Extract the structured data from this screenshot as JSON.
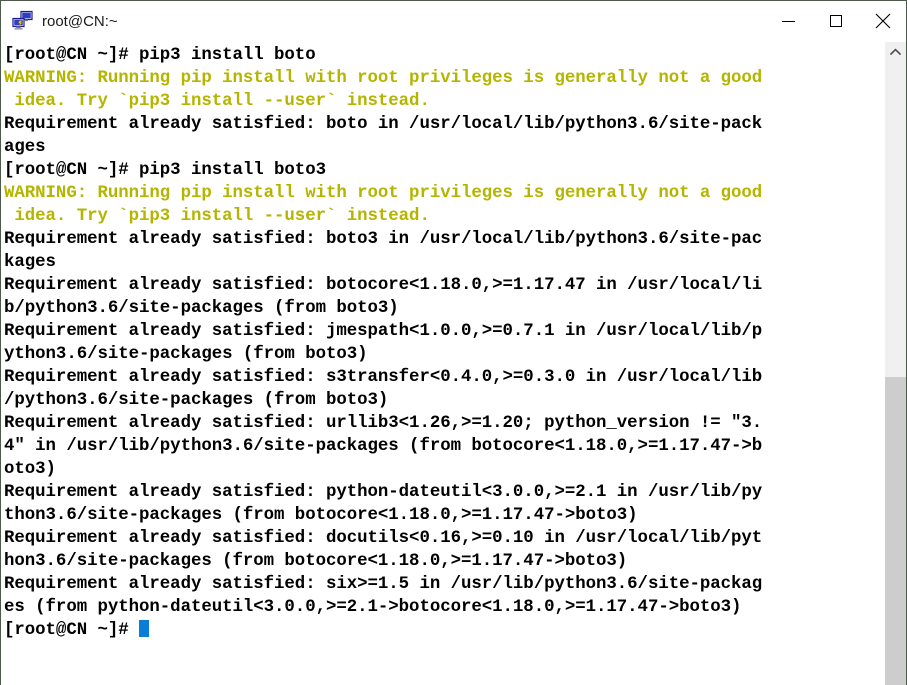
{
  "window": {
    "title": "root@CN:~",
    "icon": "putty-terminal-icon",
    "caption_buttons": [
      {
        "name": "minimize",
        "label": "—"
      },
      {
        "name": "maximize",
        "label": "□"
      },
      {
        "name": "close",
        "label": "✕"
      }
    ]
  },
  "terminal": {
    "prompt": "[root@CN ~]#",
    "colors": {
      "background": "#ffffff",
      "foreground": "#000000",
      "warning": "#b5b500",
      "cursor": "#0a7ed6"
    },
    "lines": [
      {
        "text": "[root@CN ~]# pip3 install boto",
        "color": "default"
      },
      {
        "text": "WARNING: Running pip install with root privileges is generally not a good",
        "color": "warning"
      },
      {
        "text": " idea. Try `pip3 install --user` instead.",
        "color": "warning"
      },
      {
        "text": "Requirement already satisfied: boto in /usr/local/lib/python3.6/site-pack",
        "color": "default"
      },
      {
        "text": "ages",
        "color": "default"
      },
      {
        "text": "[root@CN ~]# pip3 install boto3",
        "color": "default"
      },
      {
        "text": "WARNING: Running pip install with root privileges is generally not a good",
        "color": "warning"
      },
      {
        "text": " idea. Try `pip3 install --user` instead.",
        "color": "warning"
      },
      {
        "text": "Requirement already satisfied: boto3 in /usr/local/lib/python3.6/site-pac",
        "color": "default"
      },
      {
        "text": "kages",
        "color": "default"
      },
      {
        "text": "Requirement already satisfied: botocore<1.18.0,>=1.17.47 in /usr/local/li",
        "color": "default"
      },
      {
        "text": "b/python3.6/site-packages (from boto3)",
        "color": "default"
      },
      {
        "text": "Requirement already satisfied: jmespath<1.0.0,>=0.7.1 in /usr/local/lib/p",
        "color": "default"
      },
      {
        "text": "ython3.6/site-packages (from boto3)",
        "color": "default"
      },
      {
        "text": "Requirement already satisfied: s3transfer<0.4.0,>=0.3.0 in /usr/local/lib",
        "color": "default"
      },
      {
        "text": "/python3.6/site-packages (from boto3)",
        "color": "default"
      },
      {
        "text": "Requirement already satisfied: urllib3<1.26,>=1.20; python_version != \"3.",
        "color": "default"
      },
      {
        "text": "4\" in /usr/lib/python3.6/site-packages (from botocore<1.18.0,>=1.17.47->b",
        "color": "default"
      },
      {
        "text": "oto3)",
        "color": "default"
      },
      {
        "text": "Requirement already satisfied: python-dateutil<3.0.0,>=2.1 in /usr/lib/py",
        "color": "default"
      },
      {
        "text": "thon3.6/site-packages (from botocore<1.18.0,>=1.17.47->boto3)",
        "color": "default"
      },
      {
        "text": "Requirement already satisfied: docutils<0.16,>=0.10 in /usr/local/lib/pyt",
        "color": "default"
      },
      {
        "text": "hon3.6/site-packages (from botocore<1.18.0,>=1.17.47->boto3)",
        "color": "default"
      },
      {
        "text": "Requirement already satisfied: six>=1.5 in /usr/lib/python3.6/site-packag",
        "color": "default"
      },
      {
        "text": "es (from python-dateutil<3.0.0,>=2.1->botocore<1.18.0,>=1.17.47->boto3)",
        "color": "default"
      }
    ],
    "last_line": "[root@CN ~]# ",
    "cursor_visible": true
  },
  "scrollbar": {
    "up_arrow": "chevron-up-icon",
    "thumb_position": "bottom"
  }
}
